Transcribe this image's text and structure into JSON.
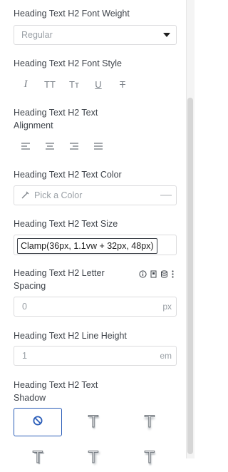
{
  "font_weight": {
    "label": "Heading Text H2 Font Weight",
    "value": "Regular"
  },
  "font_style": {
    "label": "Heading Text H2 Font Style",
    "buttons": [
      {
        "icon": "italic-icon",
        "text": "I"
      },
      {
        "icon": "uppercase-icon",
        "text": "TT"
      },
      {
        "icon": "capitalize-icon",
        "text": "Tт"
      },
      {
        "icon": "underline-icon",
        "text": "U"
      },
      {
        "icon": "strikethrough-icon",
        "text": "T"
      }
    ]
  },
  "text_alignment": {
    "label_line1": "Heading Text H2 Text",
    "label_line2": "Alignment",
    "buttons": [
      "align-left-icon",
      "align-center-icon",
      "align-right-icon",
      "align-justify-icon"
    ]
  },
  "text_color": {
    "label": "Heading Text H2 Text Color",
    "placeholder": "Pick a Color",
    "clear": "—"
  },
  "text_size": {
    "label": "Heading Text H2 Text Size",
    "value": "Clamp(36px, 1.1vw + 32px, 48px)"
  },
  "letter_spacing": {
    "label_line1": "Heading Text H2 Letter",
    "label_line2": "Spacing",
    "value": "0",
    "unit": "px"
  },
  "line_height": {
    "label": "Heading Text H2 Line Height",
    "value": "1",
    "unit": "em"
  },
  "text_shadow": {
    "label_line1": "Heading Text H2 Text",
    "label_line2": "Shadow",
    "options": [
      "no-shadow-icon",
      "shadow-preset-1-icon",
      "shadow-preset-2-icon",
      "shadow-preset-3-icon",
      "shadow-preset-4-icon",
      "shadow-preset-5-icon"
    ],
    "preset_glyph": "T"
  },
  "colors": {
    "accent": "#2b5db8",
    "text": "#3f444b",
    "muted": "#9aa0a6",
    "border": "#dcdcde"
  }
}
